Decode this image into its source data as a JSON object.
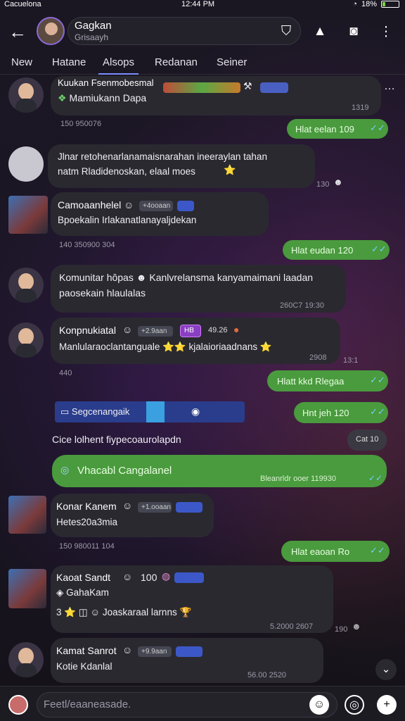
{
  "status_bar": {
    "carrier": "Cacuelona",
    "time": "12:44 PM",
    "battery": "18%"
  },
  "header": {
    "title": "Gagkan",
    "subtitle": "Grisaayh"
  },
  "tabs": [
    "New",
    "Hatane",
    "Alsops",
    "Redanan",
    "Seiner"
  ],
  "active_tab": 2,
  "messages": {
    "m1": {
      "name": "Kuukan Fsenmobesmal",
      "text": "Mamiukann Dapa",
      "meta_left": "150  950076",
      "time": "1319"
    },
    "g1": {
      "text": "Hlat  eelan  109"
    },
    "m2": {
      "line1": "Jlnar retohenarlanamaisnarahan ineeraylan tahan",
      "line2": "natm Rladidenoskan, elaal moes",
      "time": "130"
    },
    "m3": {
      "name": "Camoaanhelel",
      "badge": "+4ooaan",
      "text": "Bpoekalin Irlakanatlanayaljdekan",
      "meta_left": "140  350900  304"
    },
    "g2": {
      "text": "Hlat  eudan  120"
    },
    "m4": {
      "name": "Komunitar hôpas",
      "line1": "Kanlvrelansma kanyamaimani laadan",
      "line2": "paosekain hlaulalas",
      "time": "260C7 19:30"
    },
    "m5": {
      "name": "Konpnukiatal",
      "badge1": "+2.9aan",
      "badge2": "HB",
      "badge3": "49.26",
      "text": "Manlularaoclantanguale",
      "text2": "kjalaioriaadnans",
      "time": "2908",
      "meta_left": "440",
      "meta_right": "13:1"
    },
    "g3": {
      "text": "Hlatt  kkd  Rlegaa"
    },
    "blue_bar": {
      "label": "Segcenangaik"
    },
    "g4": {
      "text": "Hnt  jeh  120"
    },
    "system": {
      "text": "Cice lolhent fiypecoaurolapdn",
      "time": "Cat 10"
    },
    "g5": {
      "text": "Vhacabl Cangalanel",
      "time": "Bleanrldr ooer 119930"
    },
    "m6": {
      "name": "Konar Kanem",
      "badge": "+1.ooaan",
      "text": "Hetes20a3mia",
      "meta_left": "150  980011  104"
    },
    "g6": {
      "text": "Hlat  eaoan  Ro"
    },
    "m7": {
      "name": "Kaoat Sandt",
      "extra": "100",
      "sub": "GahaKam",
      "text": "Joaskaraal larnns",
      "prefix": "3",
      "time": "5.2000  2607",
      "meta_right": "190"
    },
    "m8": {
      "name": "Kamat Sanrot",
      "badge": "+9.9aan",
      "text": "Kotie Kdanlal",
      "time": "56.00  2520"
    }
  },
  "composer": {
    "placeholder": "Feetl/eaaneasade."
  },
  "colors": {
    "bubble": "#2a2930",
    "green": "#4a9a3e",
    "accent": "#7c8cff",
    "background": "#1a1722"
  },
  "icons": [
    "back-arrow-icon",
    "lock-icon",
    "bookmark-icon",
    "camera-icon",
    "more-vertical-icon",
    "check-icon",
    "emoji-icon",
    "add-icon"
  ]
}
